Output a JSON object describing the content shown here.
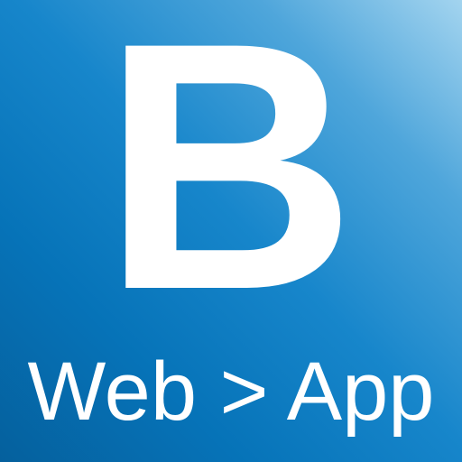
{
  "icon": {
    "letter": "B",
    "tagline": "Web > App",
    "colors": {
      "gradient_light": "#a3d4ef",
      "gradient_mid": "#1786cb",
      "gradient_dark": "#05609d",
      "text": "#ffffff"
    }
  }
}
